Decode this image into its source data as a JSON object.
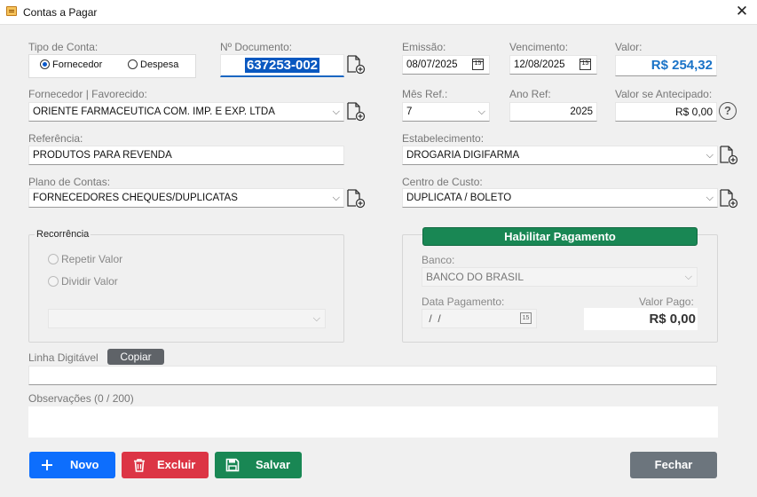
{
  "window": {
    "title": "Contas a Pagar",
    "close_glyph": "✕"
  },
  "tipo_conta": {
    "label": "Tipo de Conta:",
    "option_fornecedor": "Fornecedor",
    "option_despesa": "Despesa",
    "selected": "Fornecedor"
  },
  "documento": {
    "label": "Nº Documento:",
    "value": "637253-002"
  },
  "emissao": {
    "label": "Emissão:",
    "value": "08/07/2025"
  },
  "vencimento": {
    "label": "Vencimento:",
    "value": "12/08/2025"
  },
  "valor": {
    "label": "Valor:",
    "value": "R$ 254,32"
  },
  "fornecedor": {
    "label": "Fornecedor  |  Favorecido:",
    "value": "ORIENTE FARMACEUTICA COM. IMP. E EXP. LTDA"
  },
  "mes_ref": {
    "label": "Mês Ref.:",
    "value": "7"
  },
  "ano_ref": {
    "label": "Ano Ref:",
    "value": "2025"
  },
  "valor_antecipado": {
    "label": "Valor se Antecipado:",
    "value": "R$ 0,00",
    "help_glyph": "?"
  },
  "referencia": {
    "label": "Referência:",
    "value": "PRODUTOS PARA REVENDA"
  },
  "estabelecimento": {
    "label": "Estabelecimento:",
    "value": "DROGARIA DIGIFARMA"
  },
  "plano_contas": {
    "label": "Plano de Contas:",
    "value": "FORNECEDORES CHEQUES/DUPLICATAS"
  },
  "centro_custo": {
    "label": "Centro de Custo:",
    "value": "DUPLICATA / BOLETO"
  },
  "recorrencia": {
    "legend": "Recorrência",
    "repetir": "Repetir Valor",
    "dividir": "Dividir Valor",
    "select_value": ""
  },
  "pagamento": {
    "enable_button": "Habilitar Pagamento",
    "banco_label": "Banco:",
    "banco_value": "BANCO DO BRASIL",
    "data_label": "Data Pagamento:",
    "data_value": " /  /",
    "valor_pago_label": "Valor Pago:",
    "valor_pago_value": "R$ 0,00"
  },
  "linha_digitavel": {
    "label": "Linha Digitável",
    "copy_button": "Copiar",
    "value": ""
  },
  "observacoes": {
    "label": "Observações (0 / 200)",
    "value": ""
  },
  "buttons": {
    "novo": "Novo",
    "excluir": "Excluir",
    "salvar": "Salvar",
    "fechar": "Fechar"
  },
  "colors": {
    "primary": "#0d6efd",
    "danger": "#dc3545",
    "success": "#198754",
    "secondary": "#6c757d",
    "value_blue": "#1a73c7",
    "selection": "#0a58c0"
  },
  "icons": {
    "dropdown": "chevron-down-icon",
    "calendar": "calendar-icon",
    "add_document": "add-document-icon",
    "help": "help-circle-icon"
  }
}
